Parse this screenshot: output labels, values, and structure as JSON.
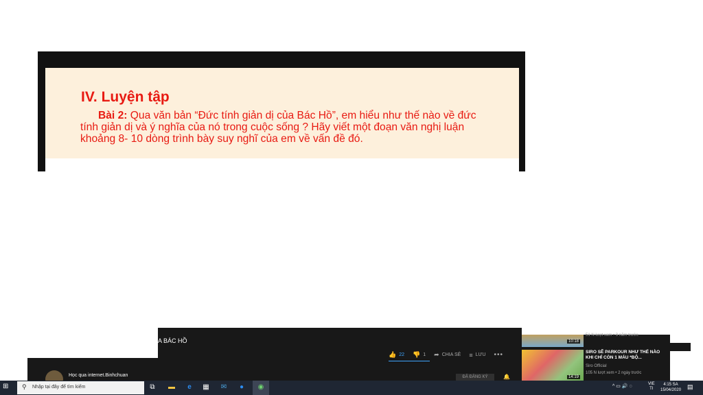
{
  "slide": {
    "heading": "IV. Luyện tập",
    "exercise_label": "Bài 2:",
    "exercise_text": " Qua văn bản “Đức tính giản dị của Bác Hồ”, em hiểu như thế nào về đức tính giản dị và ý nghĩa của nó trong cuộc sống ? Hãy viết một đoạn văn nghị luận khoảng 8- 10  dòng trình bày suy nghĩ của em về vấn đề đó.",
    "text_color": "#e81a12",
    "paper_color": "#fdf0dc"
  },
  "video": {
    "title_fragment": "A BÁC HỒ",
    "like_count": "22",
    "dislike_count": "1",
    "share_label": "CHIA SẺ",
    "save_label": "LƯU",
    "more_label": "•••",
    "accent_color": "#3ea6ff"
  },
  "channel": {
    "name": "Học qua internet.Binhchuan",
    "subscribe_label": "ĐÃ ĐĂNG KÝ"
  },
  "recommended": [
    {
      "duration": "10:18",
      "meta": "51 N lượt xem • 3 năm trước"
    },
    {
      "title": "SIRO SẼ PARKOUR NHƯ THẾ NÀO KHI CHỈ CÒN 1 MÁU *BỘ...",
      "channel": "Siro Official",
      "views": "105 N lượt xem • 2 ngày trước",
      "duration": "14:19"
    }
  ],
  "taskbar": {
    "search_placeholder": "Nhập tại đây để tìm kiếm",
    "lang_top": "VIE",
    "lang_bottom": "TI",
    "time": "4:15 SA",
    "date": "15/04/2020"
  }
}
